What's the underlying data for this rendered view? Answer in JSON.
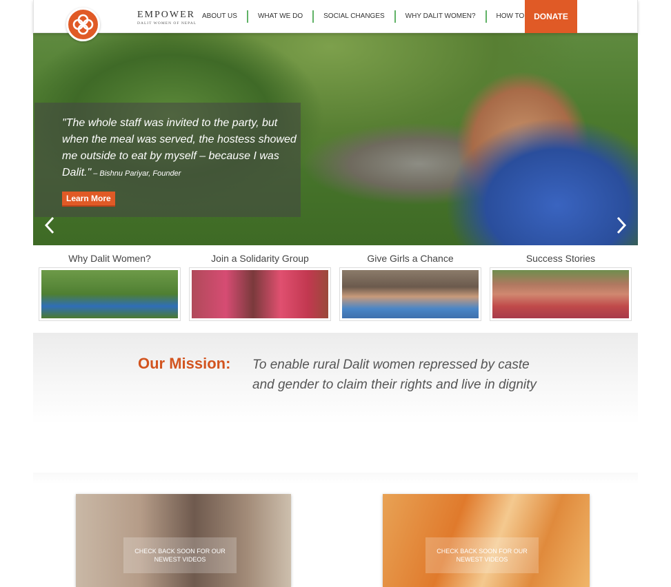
{
  "header": {
    "brand_name": "EMPOWER",
    "brand_sub": "DALIT WOMEN OF NEPAL",
    "nav": [
      "ABOUT US",
      "WHAT WE DO",
      "SOCIAL CHANGES",
      "WHY DALIT WOMEN?",
      "HOW TO HELP"
    ],
    "donate": "DONATE",
    "accent": "#e05a26",
    "divider_color": "#5fb265"
  },
  "hero": {
    "quote": "\"The whole staff was invited to the party, but when the meal was served, the hostess showed me outside to eat by myself – because I was Dalit.\"",
    "attribution": " – Bishnu Pariyar, Founder",
    "learn_more": "Learn More",
    "prev_icon": "chevron-left-icon",
    "next_icon": "chevron-right-icon"
  },
  "features": [
    {
      "label": "Why Dalit Women?"
    },
    {
      "label": "Join a Solidarity Group"
    },
    {
      "label": "Give Girls a Chance"
    },
    {
      "label": "Success Stories"
    }
  ],
  "mission": {
    "title": "Our Mission:",
    "text": "To enable rural Dalit women repressed by caste and gender to claim their rights and live in dignity"
  },
  "videos": [
    {
      "overlay": "CHECK BACK SOON FOR OUR NEWEST VIDEOS"
    },
    {
      "overlay": "CHECK BACK SOON FOR OUR NEWEST VIDEOS"
    }
  ]
}
